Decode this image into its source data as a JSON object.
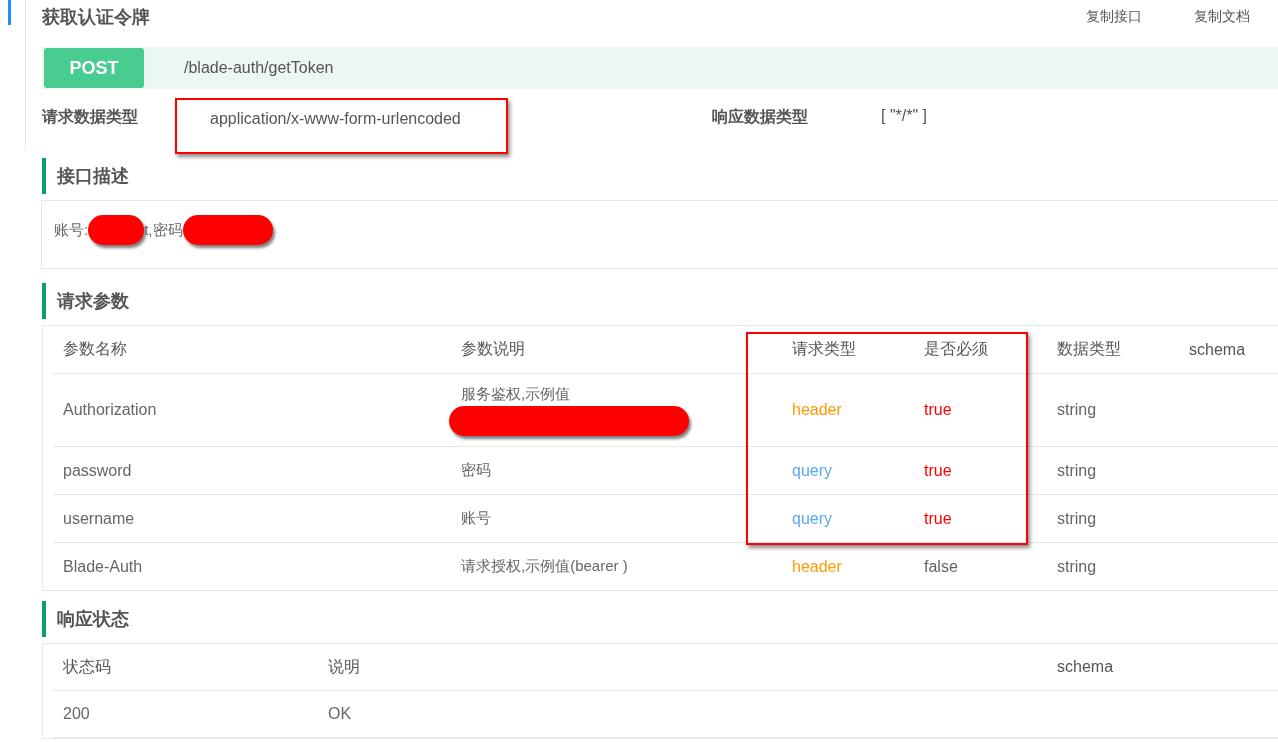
{
  "title": "获取认证令牌",
  "actions": [
    "复制接口",
    "复制文档"
  ],
  "endpoint": {
    "method": "POST",
    "path": "/blade-auth/getToken"
  },
  "request_type": {
    "label": "请求数据类型",
    "value": "application/x-www-form-urlencoded",
    "highlighted": true
  },
  "response_type": {
    "label": "响应数据类型",
    "value": "[ \"*/*\" ]"
  },
  "description": {
    "heading": "接口描述",
    "parts": [
      {
        "kind": "text",
        "text": "账号:"
      },
      {
        "kind": "redaction"
      },
      {
        "kind": "text",
        "text": "t,密码"
      },
      {
        "kind": "redaction"
      }
    ]
  },
  "parameters": {
    "heading": "请求参数",
    "highlighted": true,
    "columns": [
      "参数名称",
      "参数说明",
      "请求类型",
      "是否必须",
      "数据类型",
      "schema"
    ],
    "rows": [
      {
        "name": "Authorization",
        "description": "服务鉴权,示例值",
        "redacted": true,
        "in": {
          "text": "header",
          "color": "#ff9900"
        },
        "required": {
          "text": "true",
          "color": "#ff0000"
        },
        "type": "string"
      },
      {
        "name": "password",
        "description": "密码",
        "redacted": false,
        "in": {
          "text": "query",
          "color": "#57a9f5"
        },
        "required": {
          "text": "true",
          "color": "#ff0000"
        },
        "type": "string"
      },
      {
        "name": "username",
        "description": "账号",
        "redacted": false,
        "in": {
          "text": "query",
          "color": "#57a9f5"
        },
        "required": {
          "text": "true",
          "color": "#ff0000"
        },
        "type": "string"
      },
      {
        "name": "Blade-Auth",
        "description": "请求授权,示例值(bearer )",
        "redacted": false,
        "in": {
          "text": "header",
          "color": "#ff9900"
        },
        "required": {
          "text": "false",
          "color": "#606266"
        },
        "type": "string"
      }
    ]
  },
  "responses": {
    "heading": "响应状态",
    "columns": [
      "状态码",
      "说明",
      "schema"
    ],
    "rows": [
      [
        "200",
        "OK",
        ""
      ]
    ]
  }
}
